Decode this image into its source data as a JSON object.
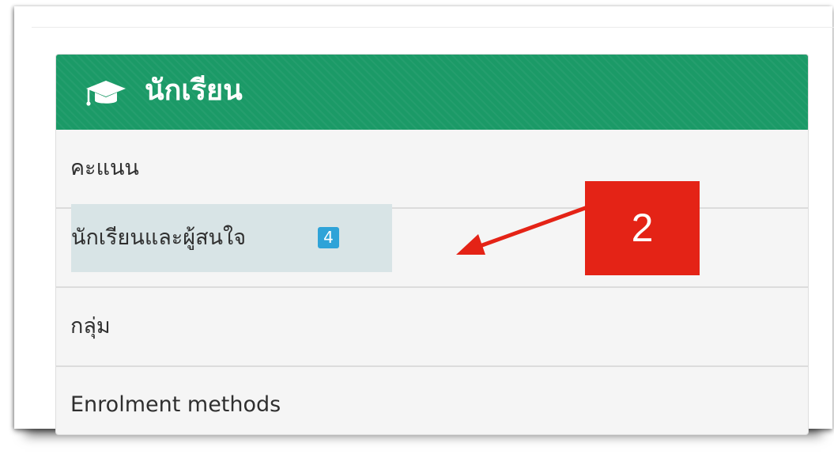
{
  "block": {
    "title": "นักเรียน",
    "header_icon": "graduation-cap-icon",
    "header_color": "#1b9a67"
  },
  "menu": {
    "items": [
      {
        "label": "คะแนน"
      },
      {
        "label": "นักเรียนและผู้สนใจ",
        "badge": "4",
        "highlighted": true
      },
      {
        "label": "กลุ่ม"
      },
      {
        "label": "Enrolment methods"
      }
    ]
  },
  "annotation": {
    "label": "2",
    "color": "#e42316",
    "arrow": "arrow-pointing-left-icon"
  }
}
